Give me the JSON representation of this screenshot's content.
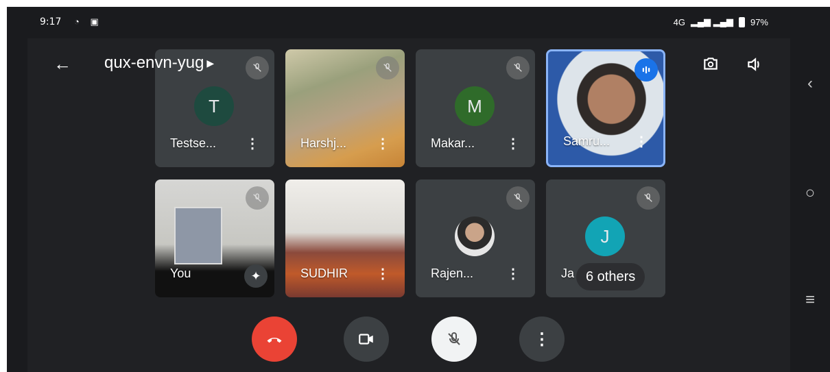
{
  "status_bar": {
    "time": "9:17",
    "network": "4G",
    "battery": "97%"
  },
  "meeting": {
    "code": "qux-envn-yug"
  },
  "participants": [
    {
      "name": "Testse...",
      "initial": "T",
      "avatar_color": "#1e4a3f",
      "muted": true
    },
    {
      "name": "Harshj...",
      "video": true,
      "muted": true
    },
    {
      "name": "Makar...",
      "initial": "M",
      "avatar_color": "#2f6b2a",
      "muted": true
    },
    {
      "name": "Samru...",
      "video": true,
      "speaking": true
    },
    {
      "name": "You",
      "video": true,
      "muted": true
    },
    {
      "name": "SUDHIR",
      "video": true
    },
    {
      "name": "Rajen...",
      "photo_avatar": true,
      "muted": true
    },
    {
      "name": "Ja",
      "initial": "J",
      "avatar_color": "#12a4b5",
      "muted": true
    }
  ],
  "others_chip": "6 others",
  "colors": {
    "end_call": "#ea4335",
    "speaking_border": "#8ab4f8",
    "tile_bg": "#3c4043",
    "background": "#202124"
  },
  "icons": {
    "back": "arrow-left-icon",
    "switch_camera": "switch-camera-icon",
    "speaker": "speaker-icon",
    "end_call": "phone-hangup-icon",
    "camera": "video-camera-icon",
    "mic": "mic-off-icon",
    "more": "more-vert-icon",
    "effects": "sparkle-icon"
  }
}
